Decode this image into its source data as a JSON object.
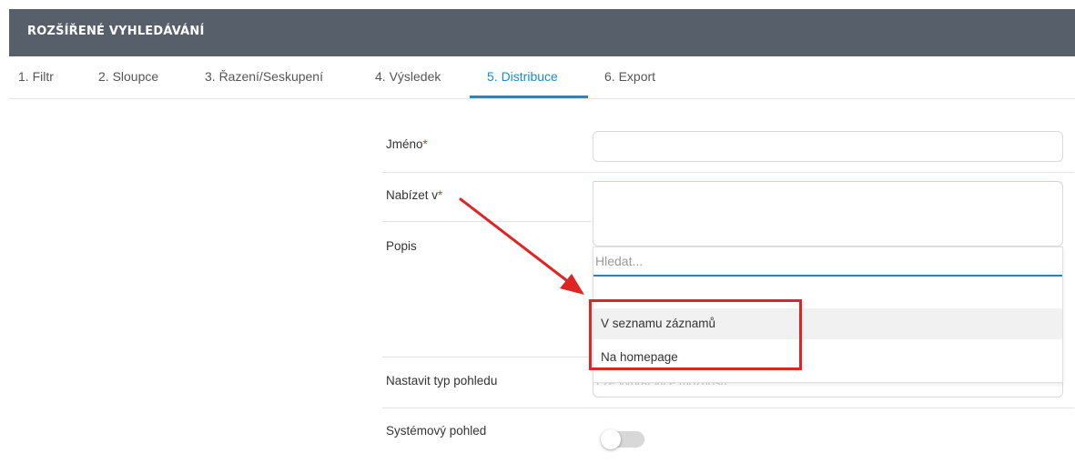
{
  "header": {
    "title": "ROZŠÍŘENÉ VYHLEDÁVÁNÍ"
  },
  "tabs": [
    {
      "label": "1. Filtr"
    },
    {
      "label": "2. Sloupce"
    },
    {
      "label": "3. Řazení/Seskupení"
    },
    {
      "label": "4. Výsledek"
    },
    {
      "label": "5. Distribuce",
      "active": true
    },
    {
      "label": "6. Export"
    }
  ],
  "form": {
    "name_label": "Jméno",
    "name_value": "",
    "required_mark": "*",
    "offer_in_label": "Nabízet v",
    "description_label": "Popis",
    "view_type_label": "Nastavit typ pohledu",
    "view_type_placeholder": "Lze vybrat více možností",
    "system_view_label": "Systémový pohled",
    "system_view_enabled": false
  },
  "dropdown": {
    "search_placeholder": "Hledat...",
    "options": [
      {
        "label": "V seznamu záznamů",
        "hovered": true
      },
      {
        "label": "Na homepage",
        "hovered": false
      }
    ]
  },
  "annotation": {
    "color": "#e02424"
  },
  "colors": {
    "header_bg": "#575f6b",
    "accent": "#1a8ad3"
  }
}
